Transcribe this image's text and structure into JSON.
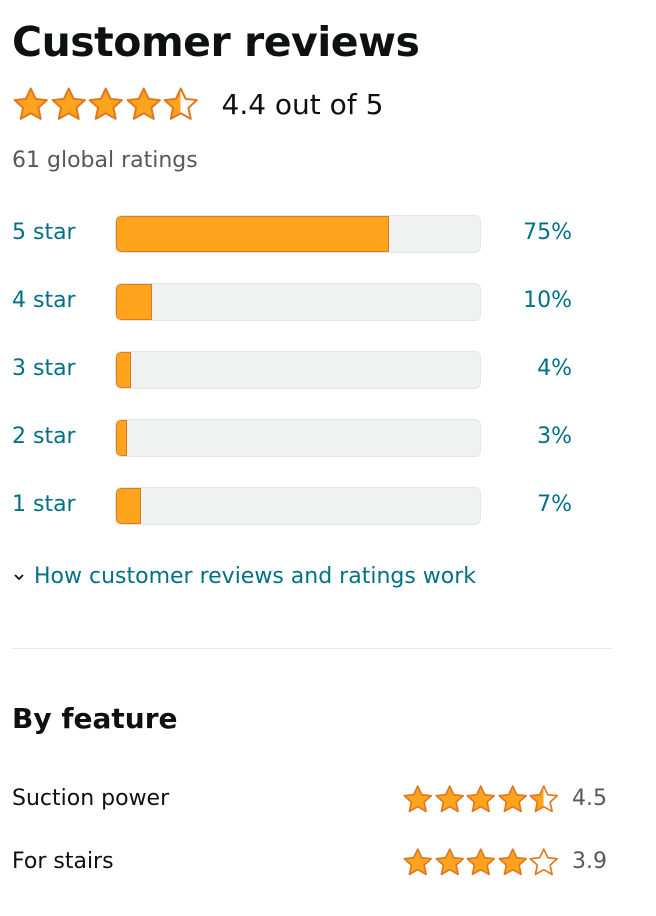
{
  "header": {
    "title": "Customer reviews",
    "rating": 4.4,
    "rating_text": "4.4 out of 5",
    "global_ratings": "61 global ratings"
  },
  "histogram": [
    {
      "label": "5 star",
      "percent": 75,
      "percent_text": "75%"
    },
    {
      "label": "4 star",
      "percent": 10,
      "percent_text": "10%"
    },
    {
      "label": "3 star",
      "percent": 4,
      "percent_text": "4%"
    },
    {
      "label": "2 star",
      "percent": 3,
      "percent_text": "3%"
    },
    {
      "label": "1 star",
      "percent": 7,
      "percent_text": "7%"
    }
  ],
  "how_link": {
    "icon": "chevron-down-icon",
    "label": "How customer reviews and ratings work"
  },
  "by_feature": {
    "title": "By feature",
    "items": [
      {
        "name": "Suction power",
        "rating": 4.5,
        "rating_text": "4.5"
      },
      {
        "name": "For stairs",
        "rating": 3.9,
        "rating_text": "3.9"
      }
    ]
  },
  "colors": {
    "star_fill": "#ffa41c",
    "star_stroke": "#de7921",
    "link": "#007185",
    "bar_bg": "#f0f2f2",
    "text": "#0f1111",
    "muted": "#565959"
  }
}
